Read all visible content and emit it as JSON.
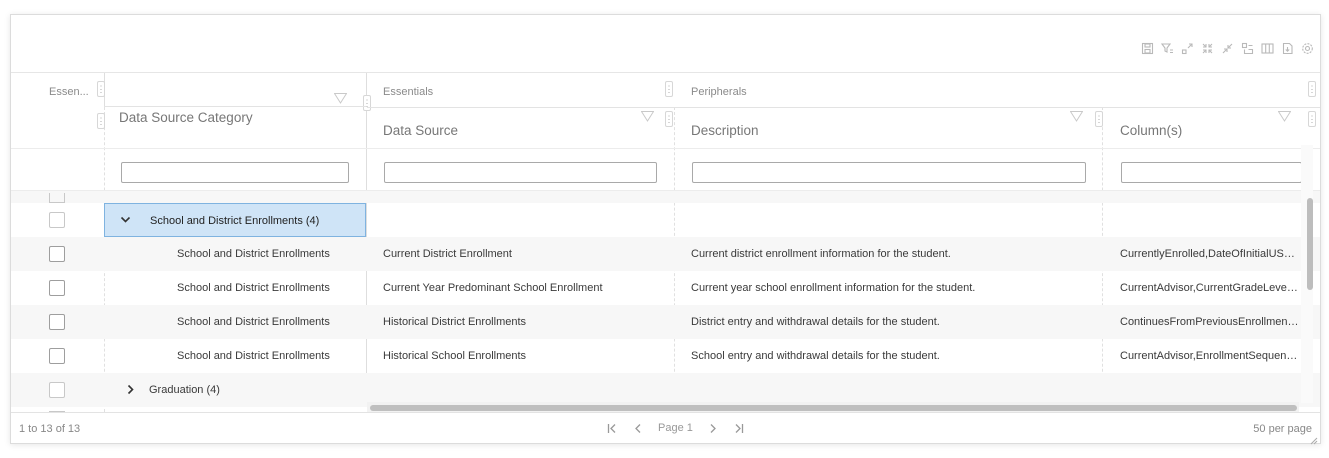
{
  "toolbar": {
    "icons": [
      "save-icon",
      "filter-clear-icon",
      "expand-icon",
      "collapse-all-icon",
      "collapse-icon",
      "group-icon",
      "columns-icon",
      "export-icon",
      "settings-icon"
    ]
  },
  "header": {
    "group_essentials_short": "Essen...",
    "group_essentials": "Essentials",
    "group_peripherals": "Peripherals",
    "col_category": "Data Source Category",
    "col_source": "Data Source",
    "col_description": "Description",
    "col_columns": "Column(s)"
  },
  "filters": {
    "category": "",
    "source": "",
    "description": "",
    "columns": ""
  },
  "rows": [
    {
      "type": "group",
      "label": "School and District Enrollments (4)",
      "expanded": true,
      "selected": true
    },
    {
      "type": "data",
      "category": "School and District Enrollments",
      "source": "Current District Enrollment",
      "description": "Current district enrollment information for the student.",
      "columns": "CurrentlyEnrolled,DateOfInitialUSEnr..."
    },
    {
      "type": "data",
      "category": "School and District Enrollments",
      "source": "Current Year Predominant School Enrollment",
      "description": "Current year school enrollment information for the student.",
      "columns": "CurrentAdvisor,CurrentGradeLevel,C..."
    },
    {
      "type": "data",
      "category": "School and District Enrollments",
      "source": "Historical District Enrollments",
      "description": "District entry and withdrawal details for the student.",
      "columns": "ContinuesFromPreviousEnrollment,C..."
    },
    {
      "type": "data",
      "category": "School and District Enrollments",
      "source": "Historical School Enrollments",
      "description": "School entry and withdrawal details for the student.",
      "columns": "CurrentAdvisor,EnrollmentSequence..."
    },
    {
      "type": "group",
      "label": "Graduation (4)",
      "expanded": false,
      "selected": false
    }
  ],
  "footer": {
    "count": "1 to 13 of 13",
    "page": "Page 1",
    "per_page": "50 per page"
  }
}
